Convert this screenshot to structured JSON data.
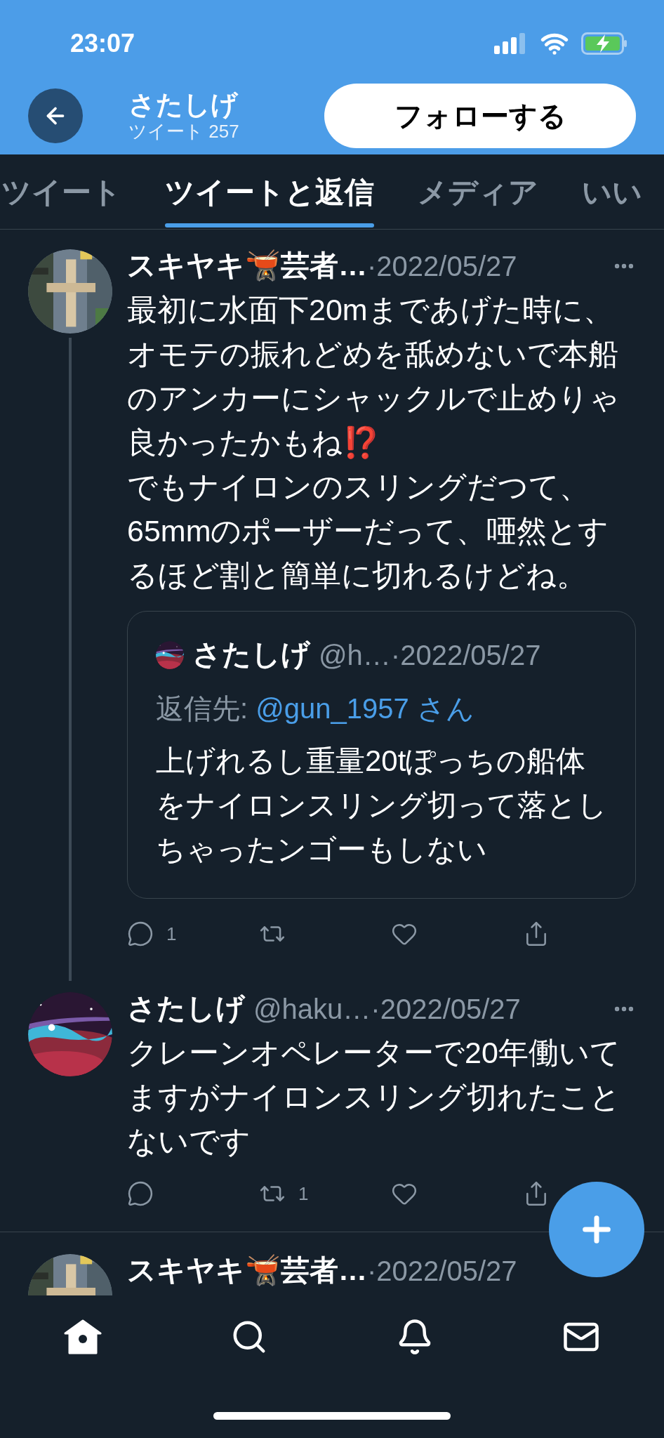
{
  "status_bar": {
    "time": "23:07"
  },
  "header": {
    "name": "さたしげ",
    "tweet_count": "ツイート 257",
    "follow_button": "フォローする"
  },
  "tabs": [
    {
      "label": "ツイート",
      "selected": false
    },
    {
      "label": "ツイートと返信",
      "selected": true
    },
    {
      "label": "メディア",
      "selected": false
    },
    {
      "label": "いい",
      "selected": false
    }
  ],
  "tweets": [
    {
      "name": "スキヤキ🫕芸者…",
      "date": "·2022/05/27",
      "thread_line": true,
      "body": "最初に水面下20mまであげた時に、オモテの振れどめを舐めないで本船のアンカーにシャックルで止めりゃ良かったかもね⁉️\nでもナイロンのスリングだつて、65mmのポーザーだって、唖然とするほど割と簡単に切れるけどね。",
      "quote": {
        "name": "さたしげ",
        "handle": "@h…",
        "date": "·2022/05/27",
        "reply_label": "返信先: ",
        "reply_to": "@gun_1957 さん",
        "body": "上げれるし重量20tぽっちの船体をナイロンスリング切って落としちゃったンゴーもしない"
      },
      "reply_count": "1"
    },
    {
      "name": "さたしげ",
      "handle": "@haku…",
      "date": "·2022/05/27",
      "thread_line": false,
      "body": "クレーンオペレーターで20年働いてますがナイロンスリング切れたことないです",
      "retweet_count": "1"
    },
    {
      "name": "スキヤキ🫕芸者…",
      "date": "·2022/05/27",
      "thread_line": false
    }
  ],
  "nav_items": [
    {
      "selected": true
    },
    {
      "selected": false
    },
    {
      "selected": false
    },
    {
      "selected": false
    }
  ]
}
